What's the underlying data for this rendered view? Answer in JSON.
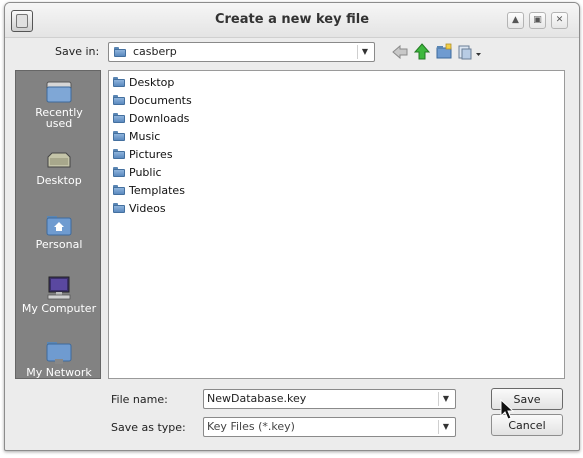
{
  "window": {
    "title": "Create a new key file",
    "controls": [
      "up-icon",
      "restore-icon",
      "close-icon"
    ]
  },
  "toolbar": {
    "save_in_label": "Save in:",
    "save_in_value": "casberp",
    "icons": [
      "back-arrow-icon",
      "up-folder-icon",
      "new-folder-icon",
      "view-menu-icon"
    ]
  },
  "places": [
    {
      "label": "Recently used",
      "icon": "recent-folder-icon"
    },
    {
      "label": "Desktop",
      "icon": "desktop-icon"
    },
    {
      "label": "Personal",
      "icon": "home-folder-icon"
    },
    {
      "label": "My Computer",
      "icon": "computer-icon"
    },
    {
      "label": "My Network",
      "icon": "network-icon"
    }
  ],
  "files": [
    {
      "name": "Desktop"
    },
    {
      "name": "Documents"
    },
    {
      "name": "Downloads"
    },
    {
      "name": "Music"
    },
    {
      "name": "Pictures"
    },
    {
      "name": "Public"
    },
    {
      "name": "Templates"
    },
    {
      "name": "Videos"
    }
  ],
  "form": {
    "file_name_label": "File name:",
    "file_name_value": "NewDatabase.key",
    "save_as_type_label": "Save as type:",
    "save_as_type_value": "Key Files (*.key)"
  },
  "buttons": {
    "save_label": "Save",
    "cancel_label": "Cancel"
  },
  "colors": {
    "sidebar": "#828282",
    "folder": "#5b89bf",
    "window": "#ececec"
  }
}
